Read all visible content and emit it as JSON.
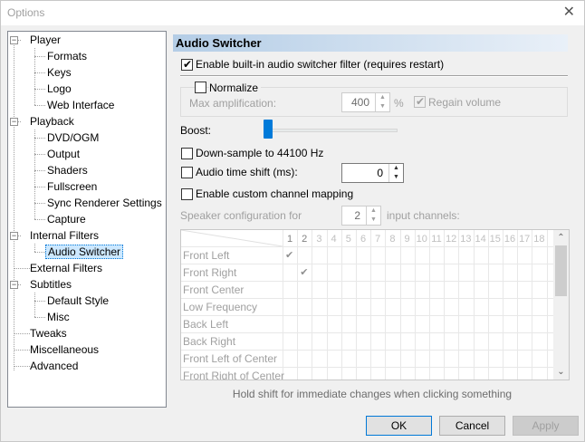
{
  "window": {
    "title": "Options",
    "close_glyph": "✕"
  },
  "tree": {
    "items": [
      {
        "label": "Player",
        "expander": "−"
      },
      {
        "label": "Formats"
      },
      {
        "label": "Keys"
      },
      {
        "label": "Logo"
      },
      {
        "label": "Web Interface"
      },
      {
        "label": "Playback",
        "expander": "−"
      },
      {
        "label": "DVD/OGM"
      },
      {
        "label": "Output"
      },
      {
        "label": "Shaders"
      },
      {
        "label": "Fullscreen"
      },
      {
        "label": "Sync Renderer Settings"
      },
      {
        "label": "Capture"
      },
      {
        "label": "Internal Filters",
        "expander": "−"
      },
      {
        "label": "Audio Switcher",
        "selected": true
      },
      {
        "label": "External Filters"
      },
      {
        "label": "Subtitles",
        "expander": "−"
      },
      {
        "label": "Default Style"
      },
      {
        "label": "Misc"
      },
      {
        "label": "Tweaks"
      },
      {
        "label": "Miscellaneous"
      },
      {
        "label": "Advanced"
      }
    ]
  },
  "panel": {
    "title": "Audio Switcher",
    "enable_filter": {
      "label": "Enable built-in audio switcher filter (requires restart)",
      "checked": true
    },
    "normalize": {
      "label": "Normalize",
      "checked": false
    },
    "max_amplification": {
      "label": "Max amplification:",
      "value": "400",
      "unit": "%"
    },
    "regain_volume": {
      "label": "Regain volume",
      "checked": true
    },
    "boost": {
      "label": "Boost:",
      "level": 0
    },
    "downsample": {
      "label": "Down-sample to 44100 Hz",
      "checked": false
    },
    "time_shift": {
      "label": "Audio time shift (ms):",
      "value": "0",
      "checked": false
    },
    "custom_mapping": {
      "label": "Enable custom channel mapping",
      "checked": false
    },
    "speaker_config": {
      "prefix": "Speaker configuration for",
      "value": "2",
      "suffix": "input channels:"
    },
    "grid": {
      "columns": [
        "1",
        "2",
        "3",
        "4",
        "5",
        "6",
        "7",
        "8",
        "9",
        "10",
        "11",
        "12",
        "13",
        "14",
        "15",
        "16",
        "17",
        "18"
      ],
      "rows": [
        "Front Left",
        "Front Right",
        "Front Center",
        "Low Frequency",
        "Back Left",
        "Back Right",
        "Front Left of Center",
        "Front Right of Center"
      ],
      "checks": [
        [
          0,
          0
        ],
        [
          1,
          1
        ]
      ],
      "check_glyph": "✔"
    },
    "hint": "Hold shift for immediate changes when clicking something"
  },
  "buttons": {
    "ok": "OK",
    "cancel": "Cancel",
    "apply": "Apply"
  },
  "glyphs": {
    "tick": "✔",
    "up": "▲",
    "down": "▼",
    "scroll_up": "⌃",
    "scroll_down": "⌄"
  },
  "colors": {
    "accent": "#0078d7",
    "selection": "#cce8ff",
    "slider_thumb": "#007ad9"
  }
}
